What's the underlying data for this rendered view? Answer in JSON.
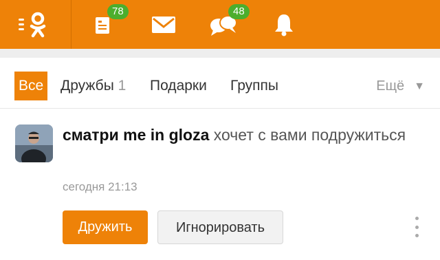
{
  "header": {
    "logo_icon": "ok-logo-icon",
    "accent_color": "#ee8208",
    "badge_color": "#4cae2d",
    "items": [
      {
        "icon": "notes-icon",
        "badge": "78"
      },
      {
        "icon": "mail-icon",
        "badge": ""
      },
      {
        "icon": "discussions-icon",
        "badge": "48"
      },
      {
        "icon": "bell-icon",
        "badge": ""
      }
    ]
  },
  "tabs": {
    "all": "Все",
    "friendships": "Дружбы",
    "friendships_count": "1",
    "gifts": "Подарки",
    "groups": "Группы",
    "more": "Ещё"
  },
  "notification": {
    "sender": "сматри me in gloza",
    "text": " хочет с вами подружиться",
    "time": "сегодня 21:13",
    "accept_label": "Дружить",
    "ignore_label": "Игнорировать",
    "menu_icon": "more-vertical-icon"
  }
}
